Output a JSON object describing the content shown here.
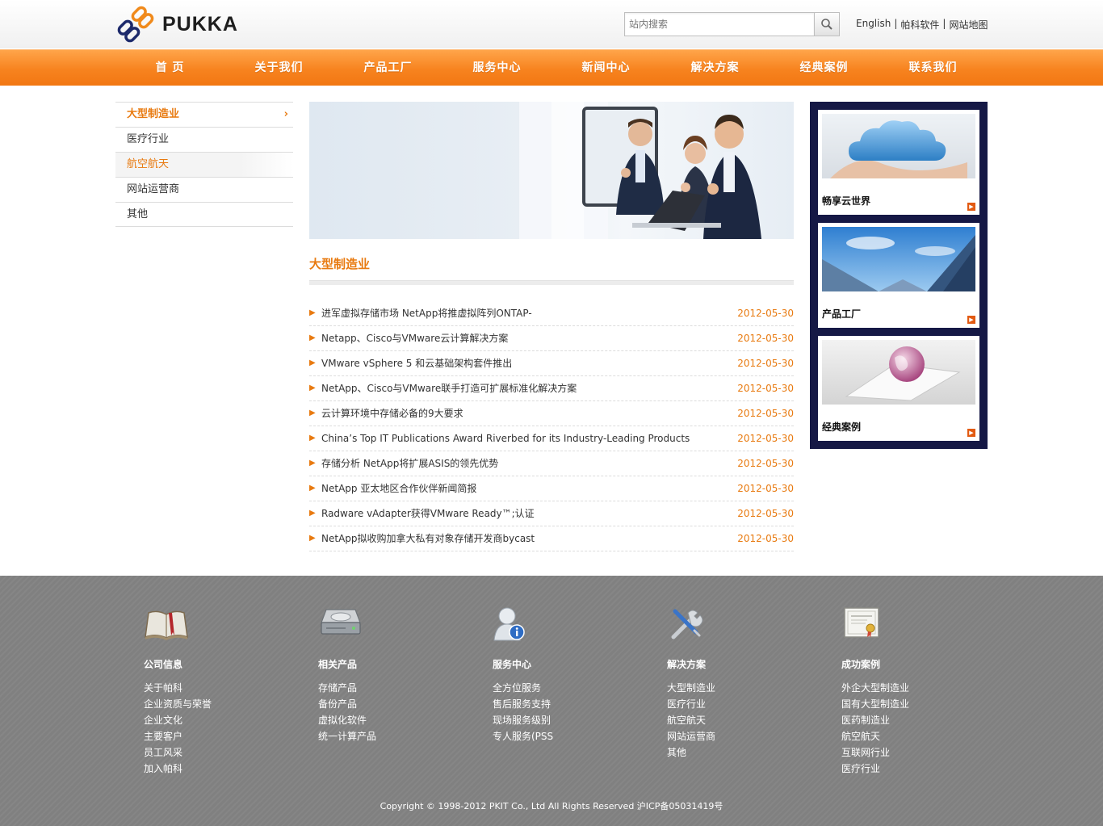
{
  "header": {
    "logo_text": "PUKKA",
    "search_placeholder": "站内搜索",
    "top_links": [
      "English",
      "帕科软件",
      "网站地图"
    ],
    "separator": "|"
  },
  "nav": {
    "items": [
      "首 页",
      "关于我们",
      "产品工厂",
      "服务中心",
      "新闻中心",
      "解决方案",
      "经典案例",
      "联系我们"
    ]
  },
  "sidebar": {
    "items": [
      "大型制造业",
      "医疗行业",
      "航空航天",
      "网站运营商",
      "其他"
    ],
    "arrow": "›"
  },
  "main": {
    "section_title": "大型制造业",
    "bullet": "▶",
    "news": [
      {
        "title": "进军虚拟存储市场 NetApp将推虚拟阵列ONTAP-",
        "date": "2012-05-30"
      },
      {
        "title": "Netapp、Cisco与VMware云计算解决方案",
        "date": "2012-05-30"
      },
      {
        "title": "VMware vSphere 5 和云基础架构套件推出",
        "date": "2012-05-30"
      },
      {
        "title": "NetApp、Cisco与VMware联手打造可扩展标准化解决方案",
        "date": "2012-05-30"
      },
      {
        "title": "云计算环境中存储必备的9大要求",
        "date": "2012-05-30"
      },
      {
        "title": "China’s Top IT Publications Award Riverbed for its Industry-Leading Products",
        "date": "2012-05-30"
      },
      {
        "title": "存储分析 NetApp将扩展ASIS的领先优势",
        "date": "2012-05-30"
      },
      {
        "title": "NetApp 亚太地区合作伙伴新闻简报",
        "date": "2012-05-30"
      },
      {
        "title": "Radware vAdapter获得VMware Ready™;认证",
        "date": "2012-05-30"
      },
      {
        "title": "NetApp拟收购加拿大私有对象存储开发商bycast",
        "date": "2012-05-30"
      }
    ]
  },
  "right_panel": {
    "cards": [
      {
        "label": "畅享云世界",
        "icon": "cloud-hands-image"
      },
      {
        "label": "产品工厂",
        "icon": "skyscraper-image"
      },
      {
        "label": "经典案例",
        "icon": "globe-laptop-image"
      }
    ],
    "arrow": "▶"
  },
  "footer": {
    "columns": [
      {
        "title": "公司信息",
        "icon": "book-icon",
        "links": [
          "关于帕科",
          "企业资质与荣誉",
          "企业文化",
          "主要客户",
          "员工风采",
          "加入帕科"
        ]
      },
      {
        "title": "相关产品",
        "icon": "hard-drive-icon",
        "links": [
          "存储产品",
          "备份产品",
          "虚拟化软件",
          "统一计算产品"
        ]
      },
      {
        "title": "服务中心",
        "icon": "user-info-icon",
        "links": [
          "全方位服务",
          "售后服务支持",
          "现场服务级别",
          "专人服务(PSS"
        ]
      },
      {
        "title": "解决方案",
        "icon": "tools-icon",
        "links": [
          "大型制造业",
          "医疗行业",
          "航空航天",
          "网站运营商",
          "其他"
        ]
      },
      {
        "title": "成功案例",
        "icon": "certificate-icon",
        "links": [
          "外企大型制造业",
          "国有大型制造业",
          "医药制造业",
          "航空航天",
          "互联网行业",
          "医疗行业"
        ]
      }
    ],
    "copyright": "Copyright © 1998-2012 PKIT Co., Ltd All Rights Reserved 沪ICP备05031419号"
  },
  "colors": {
    "accent": "#f7831f",
    "accent_text": "#e87a10",
    "panel": "#151845",
    "footer": "#808080"
  }
}
